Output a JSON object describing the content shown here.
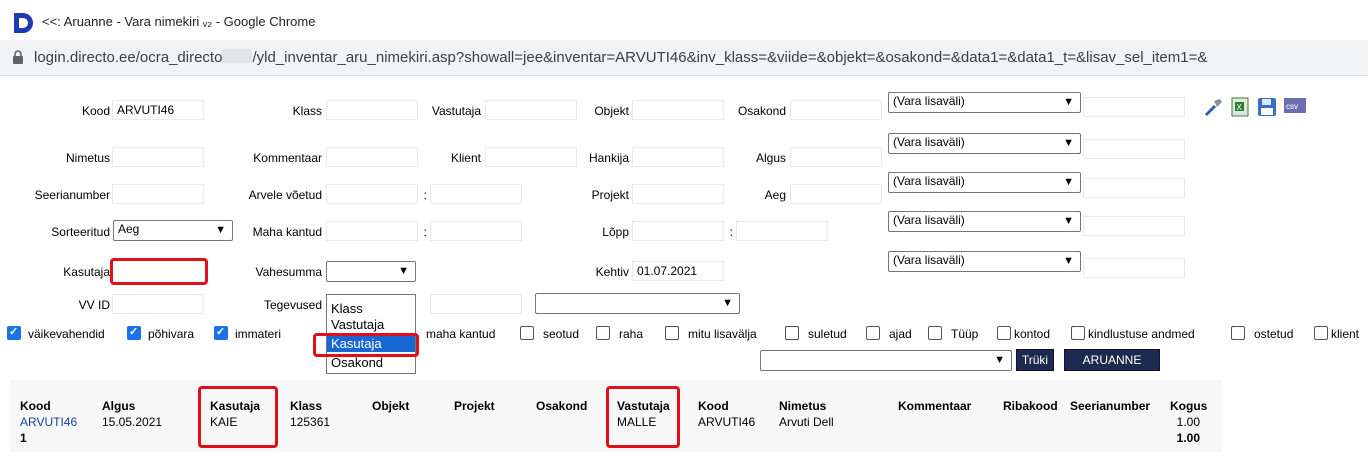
{
  "window": {
    "title": "<<: Aruanne - Vara nimekiri ᵥ₂ - Google Chrome",
    "url_before": "login.directo.ee/ocra_directo",
    "url_after": "/yld_inventar_aru_nimekiri.asp?showall=jee&inventar=ARVUTI46&inv_klass=&viide=&objekt=&osakond=&data1=&data1_t=&lisav_sel_item1=&"
  },
  "form": {
    "kood_label": "Kood",
    "kood_value": "ARVUTI46",
    "klass_label": "Klass",
    "vastutaja_label": "Vastutaja",
    "objekt_label": "Objekt",
    "osakond_label": "Osakond",
    "nimetus_label": "Nimetus",
    "kommentaar_label": "Kommentaar",
    "klient_label": "Klient",
    "hankija_label": "Hankija",
    "algus_label": "Algus",
    "seerianumber_label": "Seerianumber",
    "arvele_label": "Arvele võetud",
    "projekt_label": "Projekt",
    "aeg_label": "Aeg",
    "sorteeritud_label": "Sorteeritud",
    "sorteeritud_value": "Aeg",
    "maha_kantud_label": "Maha kantud",
    "lopp_label": "Lõpp",
    "kasutaja_label": "Kasutaja",
    "vahesumma_label": "Vahesumma",
    "kehtiv_label": "Kehtiv",
    "kehtiv_value": "01.07.2021",
    "vv_id_label": "VV ID",
    "tegevused_label": "Tegevused",
    "range_sep": ":",
    "vara_lisavali": [
      "(Vara lisaväli)",
      "(Vara lisaväli)",
      "(Vara lisaväli)",
      "(Vara lisaväli)",
      "(Vara lisaväli)"
    ]
  },
  "vahesumma_options": [
    "Klass",
    "Vastutaja",
    "Kasutaja",
    "Osakond"
  ],
  "checkboxes": {
    "vaikevahendid": "väikevahendid",
    "pohivara": "põhivara",
    "immateriaalne": "immateri",
    "maha_kantud": "maha kantud",
    "seotud": "seotud",
    "raha": "raha",
    "mitu_lisavalja": "mitu lisavälja",
    "suletud": "suletud",
    "ajad": "ajad",
    "tuup": "Tüüp",
    "kontod": "kontod",
    "kindlustuse": "kindlustuse andmed",
    "ostetud": "ostetud",
    "klient": "klient"
  },
  "buttons": {
    "truki": "Trüki",
    "aruanne": "ARUANNE"
  },
  "table": {
    "headers": [
      "Kood",
      "Algus",
      "Kasutaja",
      "Klass",
      "Objekt",
      "Projekt",
      "Osakond",
      "Vastutaja",
      "Kood",
      "Nimetus",
      "Kommentaar",
      "Ribakood",
      "Seerianumber",
      "Kogus"
    ],
    "row": {
      "kood": "ARVUTI46",
      "algus": "15.05.2021",
      "kasutaja": "KAIE",
      "klass": "125361",
      "vastutaja": "MALLE",
      "kood2": "ARVUTI46",
      "nimetus": "Arvuti Dell",
      "kogus": "1.00"
    },
    "subtotal_label": "1",
    "subtotal_value": "1.00"
  }
}
